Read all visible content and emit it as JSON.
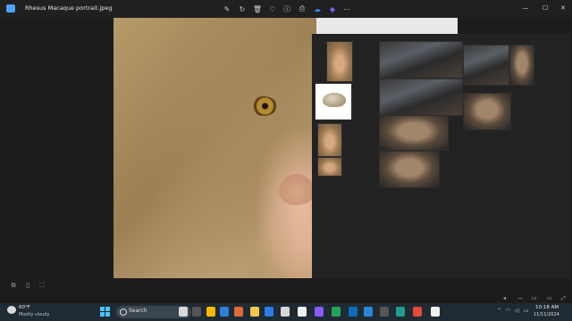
{
  "window": {
    "title": "Rhesus Macaque portrait.jpeg",
    "toolbar_icons": [
      "edit-icon",
      "rotate-icon",
      "delete-icon",
      "favorite-icon",
      "info-icon",
      "print-icon",
      "onedrive-icon",
      "copilot-icon",
      "more-icon"
    ],
    "controls": [
      "minimize",
      "maximize",
      "close"
    ]
  },
  "thumbnails": {
    "column1": [
      "rhesus-macaque-photo",
      "skull-photo",
      "macaque-thumb-small",
      "macaque-thumb-smaller"
    ],
    "column2": [
      "wukong-banner-1",
      "wukong-banner-2",
      "wukong-face-1",
      "wukong-face-2"
    ],
    "column3": [
      "wukong-poster-1",
      "wukong-poster-2",
      "wukong-poster-3"
    ]
  },
  "taskbar": {
    "weather": {
      "temp": "60°F",
      "condition": "Mostly cloudy"
    },
    "search_label": "Search",
    "clock": {
      "time": "10:18 AM",
      "date": "11/11/2024"
    }
  }
}
